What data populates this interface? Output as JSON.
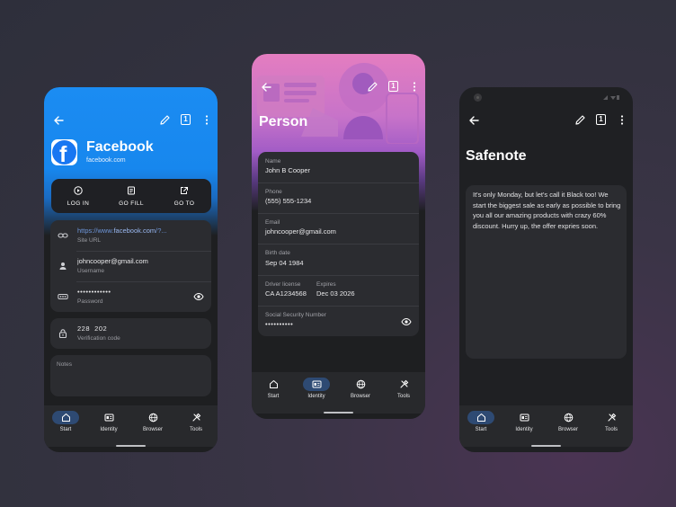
{
  "colors": {
    "blue_accent": "#1b8cf2",
    "purple_accent": "#c773c9",
    "card_bg": "#2b2c30",
    "nav_active": "#2e4a73"
  },
  "nav_items": [
    {
      "label": "Start",
      "icon": "home-icon"
    },
    {
      "label": "Identity",
      "icon": "identity-card-icon"
    },
    {
      "label": "Browser",
      "icon": "globe-icon"
    },
    {
      "label": "Tools",
      "icon": "tools-icon"
    }
  ],
  "phone1": {
    "tab_count": "1",
    "title": "Facebook",
    "subtitle": "facebook.com",
    "actions": [
      {
        "label": "LOG IN",
        "icon": "play-icon"
      },
      {
        "label": "GO FILL",
        "icon": "document-icon"
      },
      {
        "label": "GO TO",
        "icon": "open-external-icon"
      }
    ],
    "site_url_prefix": "https://www.",
    "site_url_domain": "facebook.com",
    "site_url_suffix": "/?...",
    "site_url_label": "Site URL",
    "username": "johncooper@gmail.com",
    "username_label": "Username",
    "password": "••••••••••••",
    "password_label": "Password",
    "code": "228  202",
    "code_label": "Verification code",
    "notes_label": "Notes",
    "active_nav": "Start"
  },
  "phone2": {
    "tab_count": "1",
    "title": "Person",
    "fields": {
      "name_label": "Name",
      "name": "John B Cooper",
      "phone_label": "Phone",
      "phone": "(555) 555-1234",
      "email_label": "Email",
      "email": "johncooper@gmail.com",
      "birth_label": "Birth date",
      "birth": "Sep 04 1984",
      "license_label": "Driver license",
      "license": "CA A1234568",
      "expires_label": "Expires",
      "expires": "Dec 03 2026",
      "ssn_label": "Social Security Number",
      "ssn": "••••••••••"
    },
    "active_nav": "Identity"
  },
  "phone3": {
    "tab_count": "1",
    "title": "Safenote",
    "note": "It's only Monday, but let's call it Black too! We start the biggest sale as early as possible to bring you all our amazing products with crazy 60% discount. Hurry up, the offer expries soon.",
    "active_nav": "Start"
  }
}
